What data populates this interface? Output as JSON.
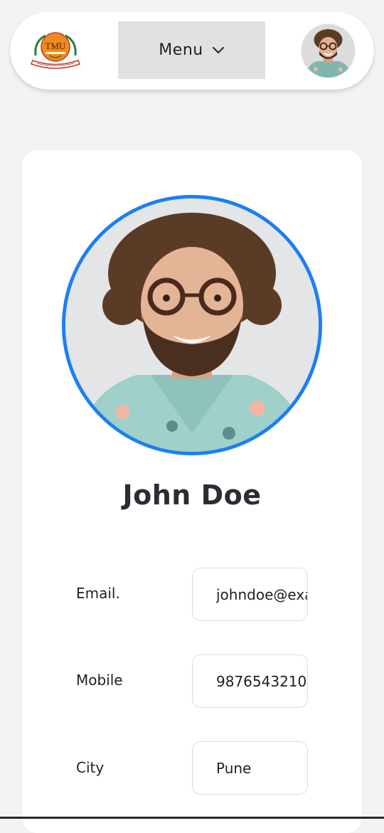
{
  "header": {
    "logo_text": "TMU",
    "menu_label": "Menu",
    "menu_icon": "chevron-down-icon",
    "avatar_icon": "user-avatar"
  },
  "profile": {
    "name": "John Doe",
    "ring_color": "#1c7ff2"
  },
  "fields": {
    "email": {
      "label": "Email.",
      "value": "johndoe@example.com"
    },
    "mobile": {
      "label": "Mobile",
      "value": "9876543210"
    },
    "city": {
      "label": "City",
      "value": "Pune"
    }
  }
}
